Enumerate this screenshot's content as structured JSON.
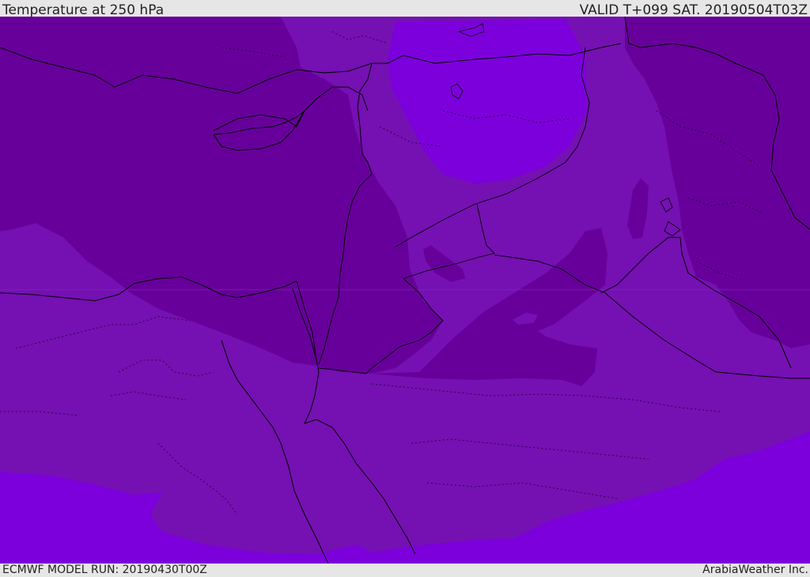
{
  "header": {
    "title": "Temperature at 250 hPa",
    "valid": "VALID T+099 SAT. 20190504T03Z"
  },
  "footer": {
    "model_run": "ECMWF MODEL RUN: 20190430T00Z",
    "credit": "ArabiaWeather Inc."
  },
  "colors": {
    "band_coldest": "#67009b",
    "band_mid": "#7510b2",
    "band_warm": "#7c00dc",
    "border_line": "#000000",
    "frame": "#e6e6e6"
  }
}
